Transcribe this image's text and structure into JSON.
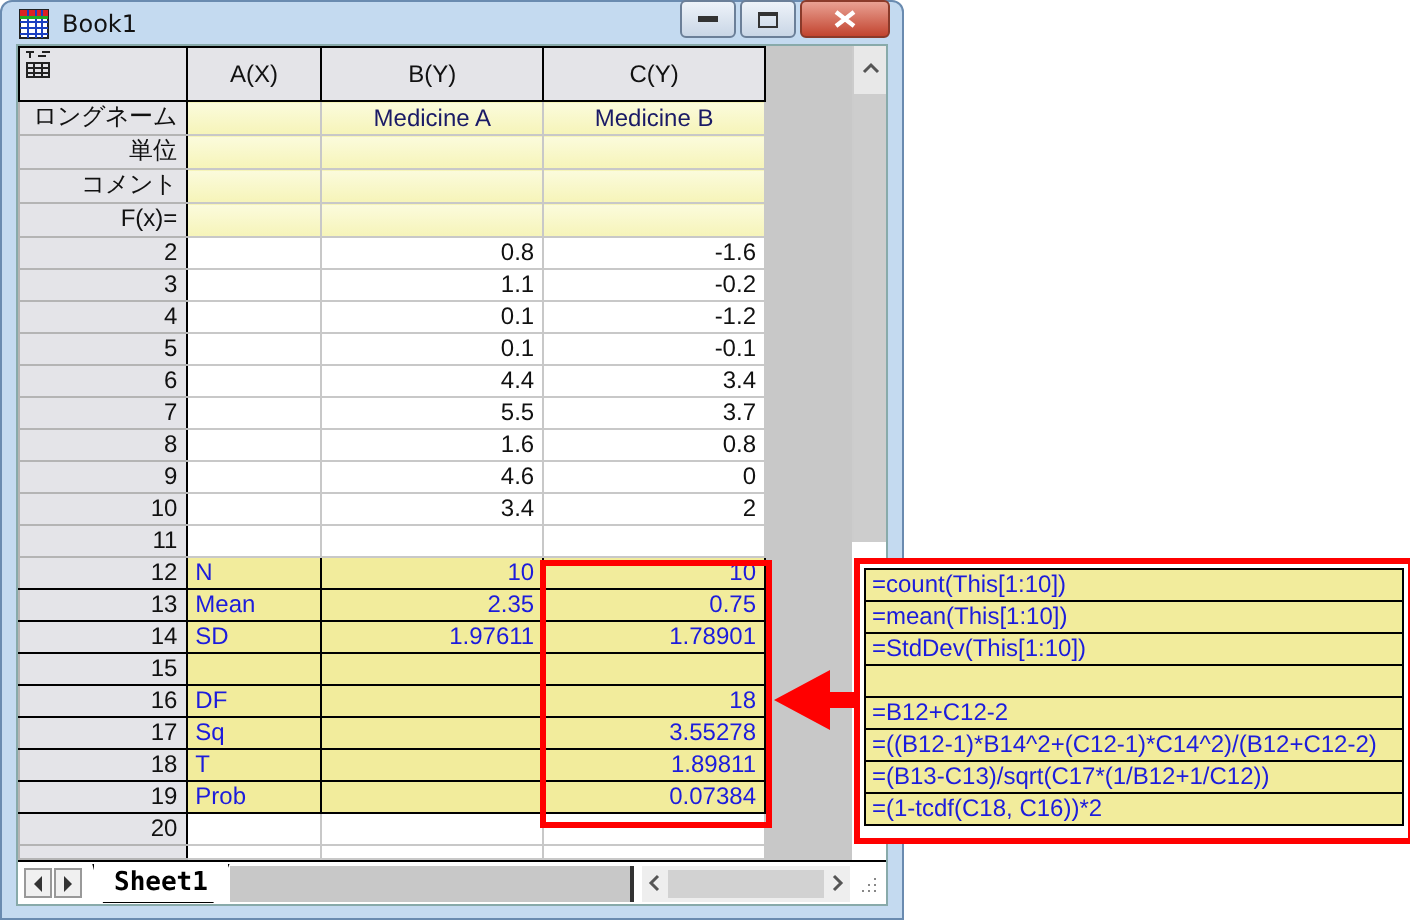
{
  "window": {
    "title": "Book1"
  },
  "columns": [
    {
      "label": "A(X)"
    },
    {
      "label": "B(Y)"
    },
    {
      "label": "C(Y)"
    }
  ],
  "label_rows": [
    {
      "label": "ロングネーム",
      "cells": [
        null,
        "Medicine A",
        "Medicine B"
      ]
    },
    {
      "label": "単位",
      "cells": [
        null,
        null,
        null
      ]
    },
    {
      "label": "コメント",
      "cells": [
        null,
        null,
        null
      ]
    },
    {
      "label": "F(x)=",
      "cells": [
        null,
        null,
        null
      ]
    }
  ],
  "rows": [
    {
      "number": "2",
      "kind": "data",
      "cells": [
        null,
        "0.8",
        "-1.6"
      ]
    },
    {
      "number": "3",
      "kind": "data",
      "cells": [
        null,
        "1.1",
        "-0.2"
      ]
    },
    {
      "number": "4",
      "kind": "data",
      "cells": [
        null,
        "0.1",
        "-1.2"
      ]
    },
    {
      "number": "5",
      "kind": "data",
      "cells": [
        null,
        "0.1",
        "-0.1"
      ]
    },
    {
      "number": "6",
      "kind": "data",
      "cells": [
        null,
        "4.4",
        "3.4"
      ]
    },
    {
      "number": "7",
      "kind": "data",
      "cells": [
        null,
        "5.5",
        "3.7"
      ]
    },
    {
      "number": "8",
      "kind": "data",
      "cells": [
        null,
        "1.6",
        "0.8"
      ]
    },
    {
      "number": "9",
      "kind": "data",
      "cells": [
        null,
        "4.6",
        "0"
      ]
    },
    {
      "number": "10",
      "kind": "data",
      "cells": [
        null,
        "3.4",
        "2"
      ]
    },
    {
      "number": "11",
      "kind": "data",
      "cells": [
        null,
        null,
        null
      ]
    },
    {
      "number": "12",
      "kind": "stat",
      "cells": [
        "N",
        "10",
        "10"
      ]
    },
    {
      "number": "13",
      "kind": "stat",
      "cells": [
        "Mean",
        "2.35",
        "0.75"
      ]
    },
    {
      "number": "14",
      "kind": "stat",
      "cells": [
        "SD",
        "1.97611",
        "1.78901"
      ]
    },
    {
      "number": "15",
      "kind": "stat",
      "cells": [
        null,
        null,
        null
      ]
    },
    {
      "number": "16",
      "kind": "stat",
      "cells": [
        "DF",
        null,
        "18"
      ]
    },
    {
      "number": "17",
      "kind": "stat",
      "cells": [
        "Sq",
        null,
        "3.55278"
      ]
    },
    {
      "number": "18",
      "kind": "stat",
      "cells": [
        "T",
        null,
        "1.89811"
      ]
    },
    {
      "number": "19",
      "kind": "stat",
      "cells": [
        "Prob",
        null,
        "0.07384"
      ]
    },
    {
      "number": "20",
      "kind": "data",
      "cells": [
        null,
        null,
        null
      ]
    }
  ],
  "sheet_tabs": [
    {
      "label": "Sheet1",
      "selected": true
    }
  ],
  "formulas": [
    {
      "kind": "formula",
      "text": "=count(This[1:10])"
    },
    {
      "kind": "formula",
      "text": "=mean(This[1:10])"
    },
    {
      "kind": "formula",
      "text": "=StdDev(This[1:10])"
    },
    {
      "kind": "empty"
    },
    {
      "kind": "formula",
      "text": "=B12+C12-2"
    },
    {
      "kind": "formula",
      "text": "=((B12-1)*B14^2+(C12-1)*C14^2)/(B12+C12-2)"
    },
    {
      "kind": "formula",
      "text": "=(B13-C13)/sqrt(C17*(1/B12+1/C12))"
    },
    {
      "kind": "formula",
      "text": "=(1-tcdf(C18, C16))*2"
    }
  ]
}
